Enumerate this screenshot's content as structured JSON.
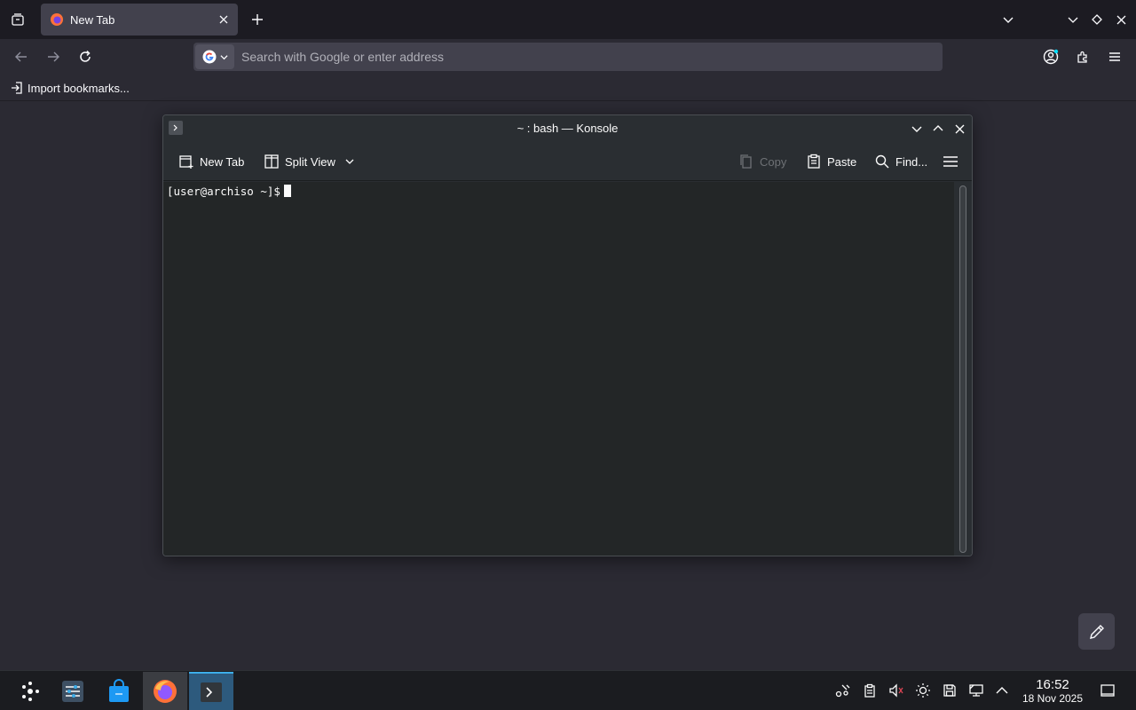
{
  "browser": {
    "tab": {
      "title": "New Tab"
    },
    "urlbar": {
      "placeholder": "Search with Google or enter address"
    },
    "bookmarks": {
      "import_label": "Import bookmarks..."
    }
  },
  "konsole": {
    "title": "~ : bash — Konsole",
    "toolbar": {
      "new_tab": "New Tab",
      "split_view": "Split View",
      "copy": "Copy",
      "paste": "Paste",
      "find": "Find..."
    },
    "prompt": "[user@archiso ~]$"
  },
  "taskbar": {
    "clock_time": "16:52",
    "clock_date": "18 Nov 2025"
  },
  "colors": {
    "browser_bg": "#2b2a33",
    "tabstrip_bg": "#1c1b22",
    "terminal_bg": "#232627",
    "accent_blue": "#3daee9"
  }
}
